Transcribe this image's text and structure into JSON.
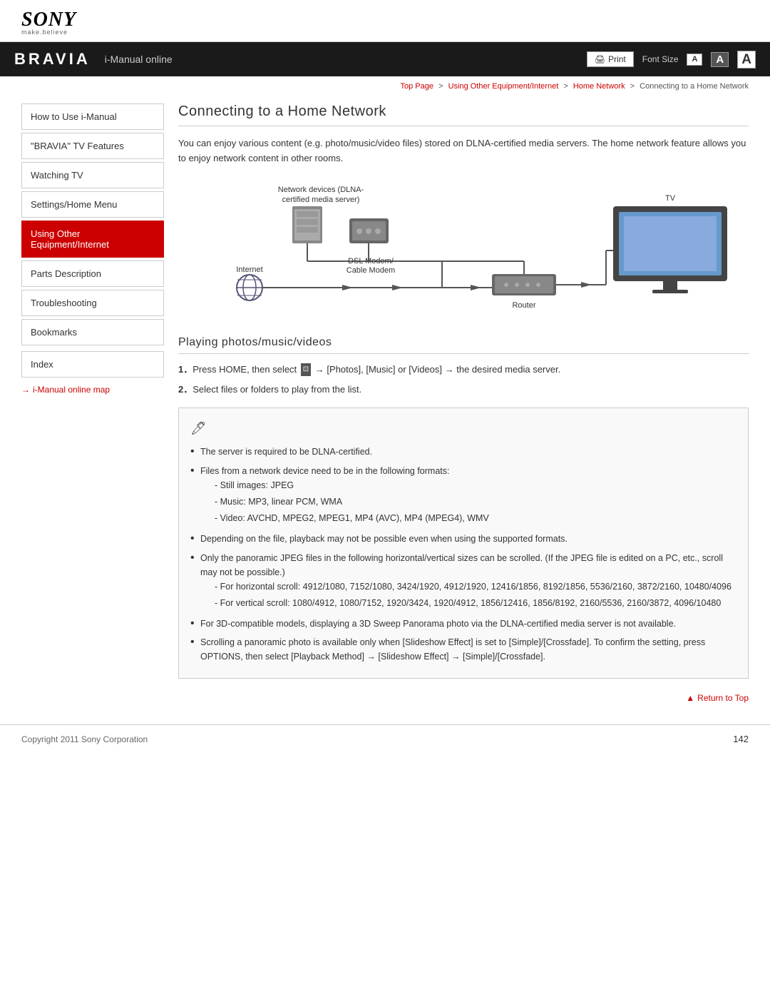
{
  "header": {
    "sony_logo": "SONY",
    "make_believe": "make.believe"
  },
  "navbar": {
    "bravia": "BRAVIA",
    "title": "i-Manual online",
    "print_label": "Print",
    "font_size_label": "Font Size",
    "font_small": "A",
    "font_medium": "A",
    "font_large": "A"
  },
  "breadcrumb": {
    "top_page": "Top Page",
    "sep1": ">",
    "item1": "Using Other Equipment/Internet",
    "sep2": ">",
    "item2": "Home Network",
    "sep3": ">",
    "item3": "Connecting to a Home Network"
  },
  "sidebar": {
    "items": [
      {
        "label": "How to Use i-Manual",
        "active": false
      },
      {
        "label": "\"BRAVIA\" TV Features",
        "active": false
      },
      {
        "label": "Watching TV",
        "active": false
      },
      {
        "label": "Settings/Home Menu",
        "active": false
      },
      {
        "label": "Using Other Equipment/Internet",
        "active": true
      },
      {
        "label": "Parts Description",
        "active": false
      },
      {
        "label": "Troubleshooting",
        "active": false
      },
      {
        "label": "Bookmarks",
        "active": false
      }
    ],
    "index_label": "Index",
    "map_label": "i-Manual online map",
    "map_arrow": "→"
  },
  "content": {
    "page_title": "Connecting to a Home Network",
    "intro": "You can enjoy various content (e.g. photo/music/video files) stored on DLNA-certified media servers. The home network feature allows you to enjoy network content in other rooms.",
    "diagram": {
      "network_devices_label": "Network devices (DLNA-\ncertified media server)",
      "dsl_label": "DSL Modem/\nCable Modem",
      "internet_label": "Internet",
      "router_label": "Router",
      "tv_label": "TV"
    },
    "section2_title": "Playing photos/music/videos",
    "steps": [
      {
        "num": "1．",
        "text": "Press HOME, then select",
        "icon": "⊡",
        "text2": "→ [Photos], [Music] or [Videos] → the desired media server."
      },
      {
        "num": "2．",
        "text": "Select files or folders to play from the list."
      }
    ],
    "note_icon": "🖊",
    "notes": [
      {
        "bullet": "•",
        "text": "The server is required to be DLNA-certified."
      },
      {
        "bullet": "•",
        "text": "Files from a network device need to be in the following formats:",
        "subs": [
          "- Still images: JPEG",
          "- Music: MP3, linear PCM, WMA",
          "- Video: AVCHD, MPEG2, MPEG1, MP4 (AVC), MP4 (MPEG4), WMV"
        ]
      },
      {
        "bullet": "•",
        "text": "Depending on the file, playback may not be possible even when using the supported formats."
      },
      {
        "bullet": "•",
        "text": "Only the panoramic JPEG files in the following horizontal/vertical sizes can be scrolled. (If the JPEG file is edited on a PC, etc., scroll may not be possible.)",
        "subs": [
          "- For horizontal scroll: 4912/1080, 7152/1080, 3424/1920, 4912/1920, 12416/1856, 8192/1856, 5536/2160, 3872/2160, 10480/4096",
          "- For vertical scroll: 1080/4912, 1080/7152, 1920/3424, 1920/4912, 1856/12416, 1856/8192, 2160/5536, 2160/3872, 4096/10480"
        ]
      },
      {
        "bullet": "•",
        "text": "For 3D-compatible models, displaying a 3D Sweep Panorama photo via the DLNA-certified media server is not available."
      },
      {
        "bullet": "•",
        "text": "Scrolling a panoramic photo is available only when [Slideshow Effect] is set to [Simple]/[Crossfade]. To confirm the setting, press OPTIONS, then select [Playback Method] → [Slideshow Effect] → [Simple]/[Crossfade]."
      }
    ],
    "return_top": "Return to Top",
    "return_arrow": "▲"
  },
  "footer": {
    "copyright": "Copyright 2011 Sony Corporation",
    "page_num": "142"
  }
}
